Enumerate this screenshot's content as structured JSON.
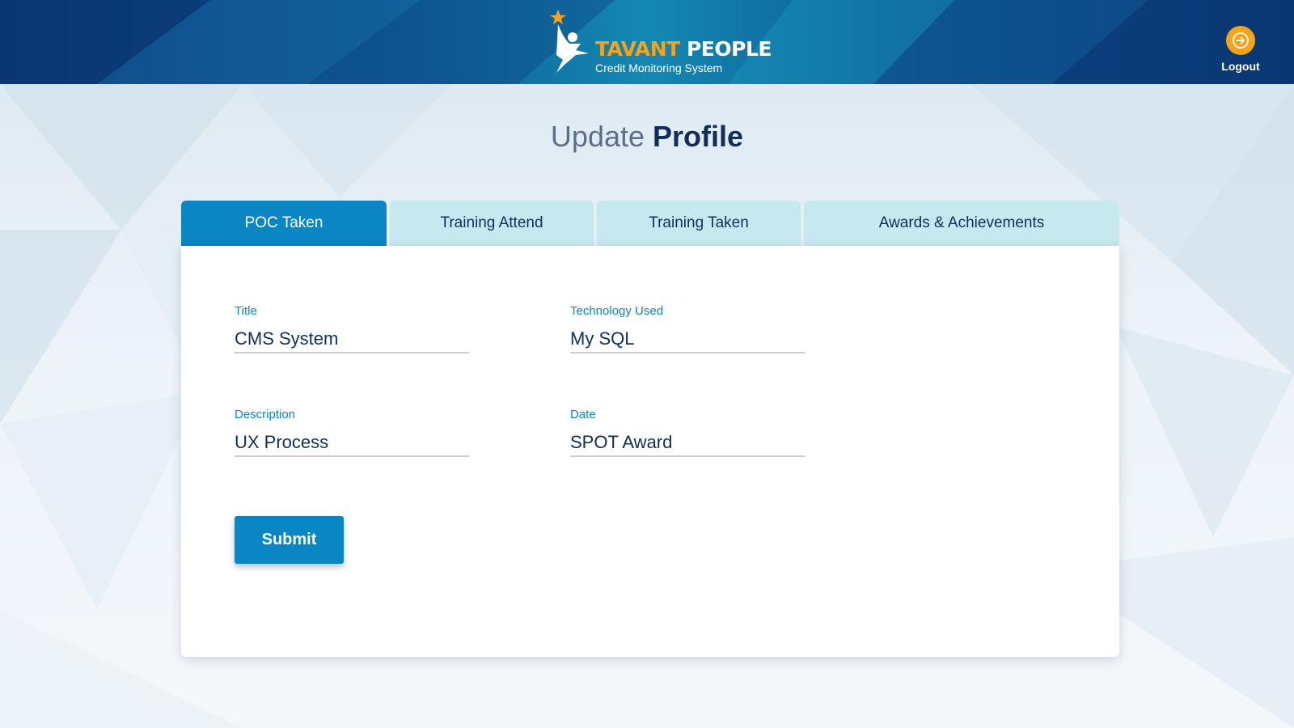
{
  "header": {
    "brand_part1": "TAVANT",
    "brand_part2": "PEOPLE",
    "subtitle": "Credit Monitoring System",
    "logout_label": "Logout",
    "logout_icon": "arrow-circle-right-icon",
    "colors": {
      "brand_orange": "#f7a21b",
      "header_blue": "#0d5a94"
    }
  },
  "page": {
    "title_light": "Update",
    "title_dark": "Profile"
  },
  "tabs": [
    {
      "label": "POC Taken",
      "active": true
    },
    {
      "label": "Training Attend",
      "active": false
    },
    {
      "label": "Training Taken",
      "active": false
    },
    {
      "label": "Awards & Achievements",
      "active": false
    }
  ],
  "form": {
    "title": {
      "label": "Title",
      "value": "CMS System"
    },
    "technology": {
      "label": "Technology Used",
      "value": "My SQL"
    },
    "description": {
      "label": "Description",
      "value": "UX Process"
    },
    "date": {
      "label": "Date",
      "value": "SPOT Award"
    },
    "submit_label": "Submit"
  },
  "colors": {
    "accent": "#0a86c5",
    "tab_inactive": "#c6e8ef",
    "text_dark": "#0f2f5a"
  }
}
